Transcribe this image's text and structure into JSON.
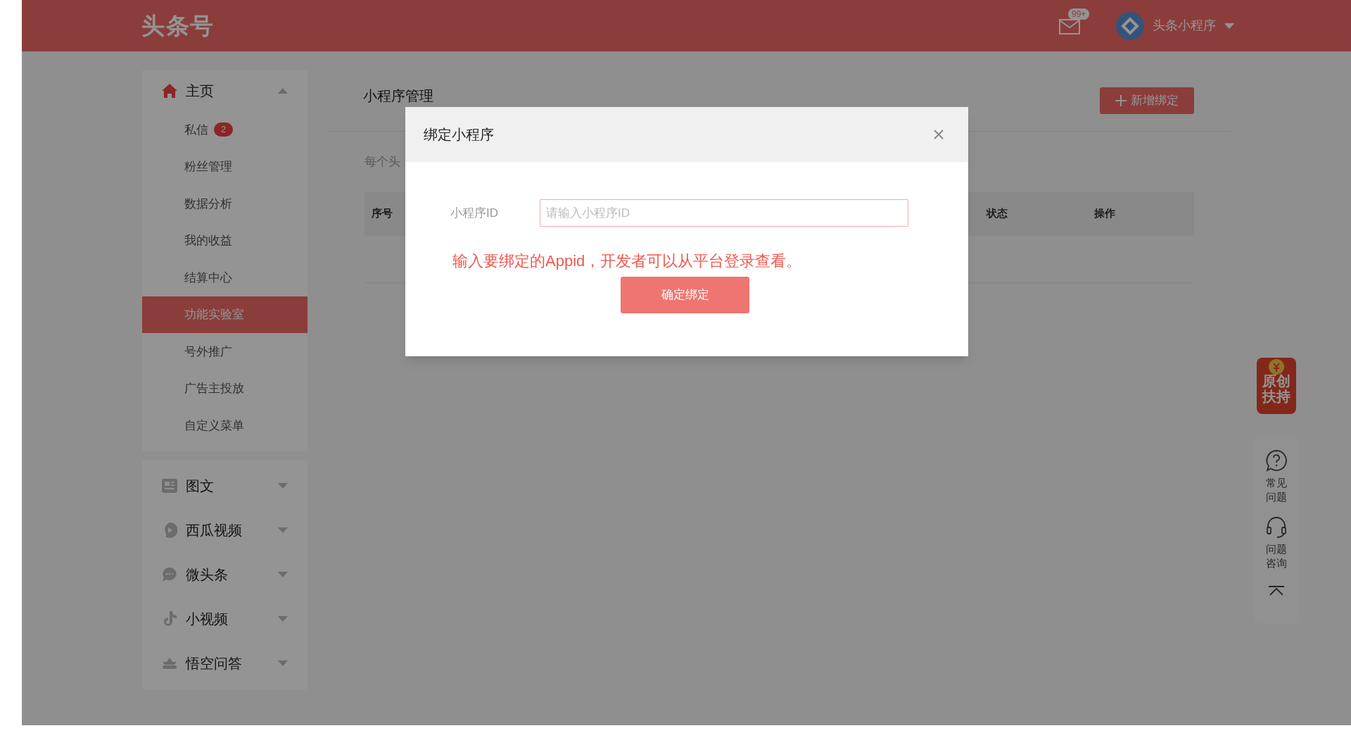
{
  "header": {
    "logo": "头条号",
    "mail_badge": "99+",
    "user_name": "头条小程序"
  },
  "sidebar": [
    {
      "kind": "home",
      "label": "主页",
      "expanded": true,
      "children": [
        {
          "label": "私信",
          "badge": "2",
          "selected": false
        },
        {
          "label": "粉丝管理",
          "selected": false
        },
        {
          "label": "数据分析",
          "selected": false
        },
        {
          "label": "我的收益",
          "selected": false
        },
        {
          "label": "结算中心",
          "selected": false
        },
        {
          "label": "功能实验室",
          "selected": true
        },
        {
          "label": "号外推广",
          "selected": false
        },
        {
          "label": "广告主投放",
          "selected": false
        },
        {
          "label": "自定义菜单",
          "selected": false
        }
      ]
    },
    {
      "kind": "article",
      "label": "图文",
      "expanded": false
    },
    {
      "kind": "video",
      "label": "西瓜视频",
      "expanded": false
    },
    {
      "kind": "chat",
      "label": "微头条",
      "expanded": false
    },
    {
      "kind": "short-video",
      "label": "小视频",
      "expanded": false
    },
    {
      "kind": "qa",
      "label": "悟空问答",
      "expanded": false
    }
  ],
  "main": {
    "title": "小程序管理",
    "add_button": "新增绑定",
    "description": "每个头",
    "table": {
      "columns": [
        "序号",
        "状态",
        "操作"
      ]
    }
  },
  "dialog": {
    "title": "绑定小程序",
    "field_label": "小程序ID",
    "placeholder": "请输入小程序ID",
    "hint": "输入要绑定的Appid，开发者可以从平台登录查看。",
    "confirm_button": "确定绑定"
  },
  "side_tools": {
    "promo": [
      "原创",
      "扶持"
    ],
    "items": [
      {
        "kind": "faq",
        "label": "常见问题"
      },
      {
        "kind": "support",
        "label": "问题咨询"
      }
    ]
  }
}
